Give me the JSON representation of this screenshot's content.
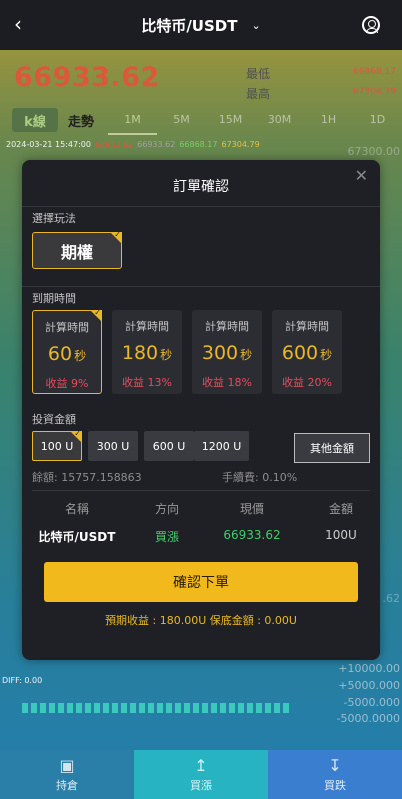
{
  "header": {
    "title": "比特币/USDT"
  },
  "price": {
    "current": "66933.62",
    "low_label": "最低",
    "high_label": "最高",
    "low": "66868.17",
    "high": "67304.79"
  },
  "tabs": {
    "kline": "k線",
    "trend": "走勢",
    "times": [
      "1M",
      "5M",
      "15M",
      "30M",
      "1H",
      "1D"
    ],
    "active": "1M"
  },
  "quote": {
    "datetime": "2024-03-21 15:47:00",
    "v1": "66933.62",
    "v2": "66933.62",
    "v3": "66868.17",
    "v4": "67304.79"
  },
  "axis": {
    "top": "67300.00",
    "mid": ".62",
    "diff": "DIFF: 0.00",
    "macd": [
      "+10000.00",
      "+5000.000",
      "-5000.000",
      "-5000.0000"
    ]
  },
  "modal": {
    "title": "訂單確認",
    "play_label": "選擇玩法",
    "play_option": "期權",
    "expiry_label": "到期時間",
    "times": [
      {
        "top": "計算時間",
        "num": "60",
        "unit": "秒",
        "profit": "收益 9%"
      },
      {
        "top": "計算時間",
        "num": "180",
        "unit": "秒",
        "profit": "收益 13%"
      },
      {
        "top": "計算時間",
        "num": "300",
        "unit": "秒",
        "profit": "收益 18%"
      },
      {
        "top": "計算時間",
        "num": "600",
        "unit": "秒",
        "profit": "收益 20%"
      }
    ],
    "amount_label": "投資金額",
    "amounts": [
      "100 U",
      "300 U",
      "600 U",
      "1200 U"
    ],
    "other_amount": "其他金額",
    "balance": "餘額: 15757.158863",
    "fee": "手續費: 0.10%",
    "table": {
      "headers": [
        "名稱",
        "方向",
        "現價",
        "金額"
      ],
      "name": "比特币/USDT",
      "direction": "買漲",
      "price": "66933.62",
      "amount": "100U"
    },
    "confirm": "確認下單",
    "expected": "預期收益 : 180.00U    保底金額 : 0.00U"
  },
  "footer": {
    "hold": "持倉",
    "up": "買漲",
    "down": "買跌"
  },
  "colors": {
    "accent": "#f2b91d",
    "up": "#3ecf6a",
    "down": "#e84a5a"
  }
}
